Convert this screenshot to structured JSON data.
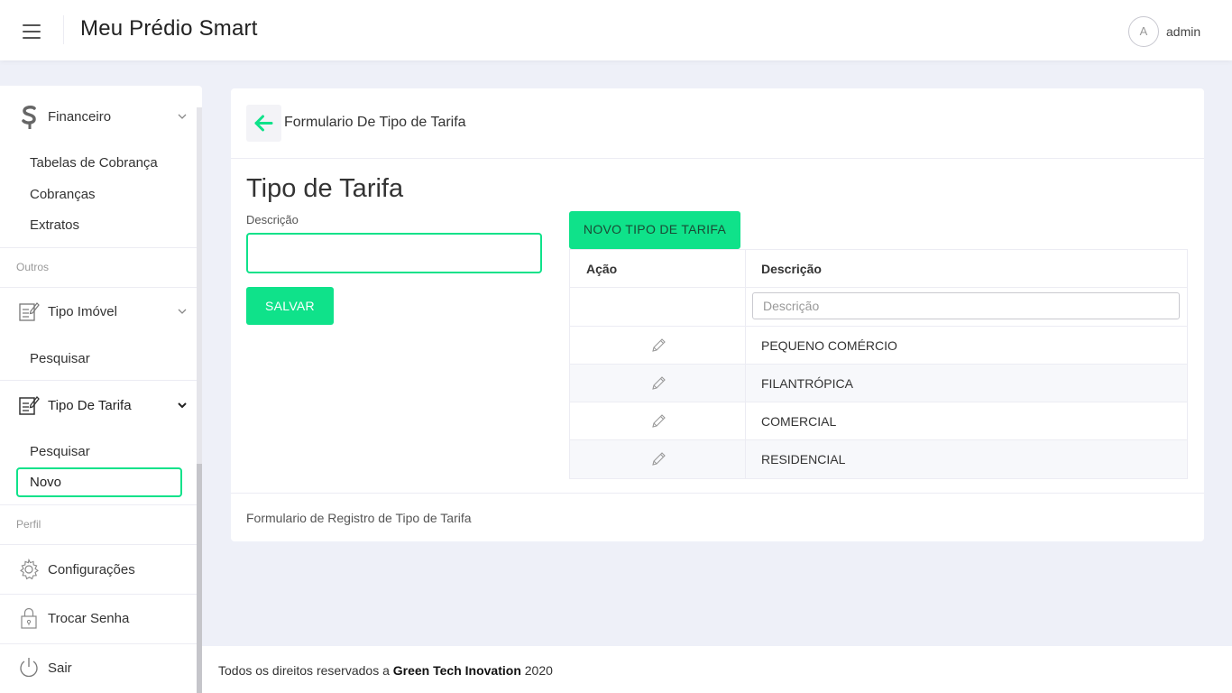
{
  "header": {
    "app_title": "Meu Prédio Smart",
    "avatar_initial": "A",
    "username": "admin"
  },
  "sidebar": {
    "financeiro": {
      "label": "Financeiro",
      "icon": "dollar-icon",
      "items": [
        "Tabelas de Cobrança",
        "Cobranças",
        "Extratos"
      ]
    },
    "section_outros": "Outros",
    "tipo_imovel": {
      "label": "Tipo Imóvel",
      "icon": "edit-document-icon",
      "items": [
        "Pesquisar"
      ]
    },
    "tipo_tarifa": {
      "label": "Tipo De Tarifa",
      "icon": "edit-document-icon",
      "items": [
        "Pesquisar",
        "Novo"
      ],
      "active": "Novo"
    },
    "section_perfil": "Perfil",
    "configuracoes": "Configurações",
    "trocar_senha": "Trocar Senha",
    "sair": "Sair"
  },
  "card": {
    "title": "Formulario De Tipo de Tarifa",
    "heading": "Tipo de Tarifa",
    "field_label": "Descrição",
    "field_value": "",
    "save_label": "SALVAR",
    "new_label": "NOVO TIPO DE TARIFA",
    "footer_text": "Formulario de Registro de Tipo de Tarifa"
  },
  "table": {
    "columns": [
      "Ação",
      "Descrição"
    ],
    "filter_placeholder": "Descrição",
    "rows": [
      "PEQUENO COMÉRCIO",
      "FILANTRÓPICA",
      "COMERCIAL",
      "RESIDENCIAL"
    ]
  },
  "footer": {
    "prefix": "Todos os direitos reservados a ",
    "company": "Green Tech Inovation",
    "year": " 2020"
  },
  "colors": {
    "accent": "#0fe28a",
    "background": "#eef0f8"
  }
}
